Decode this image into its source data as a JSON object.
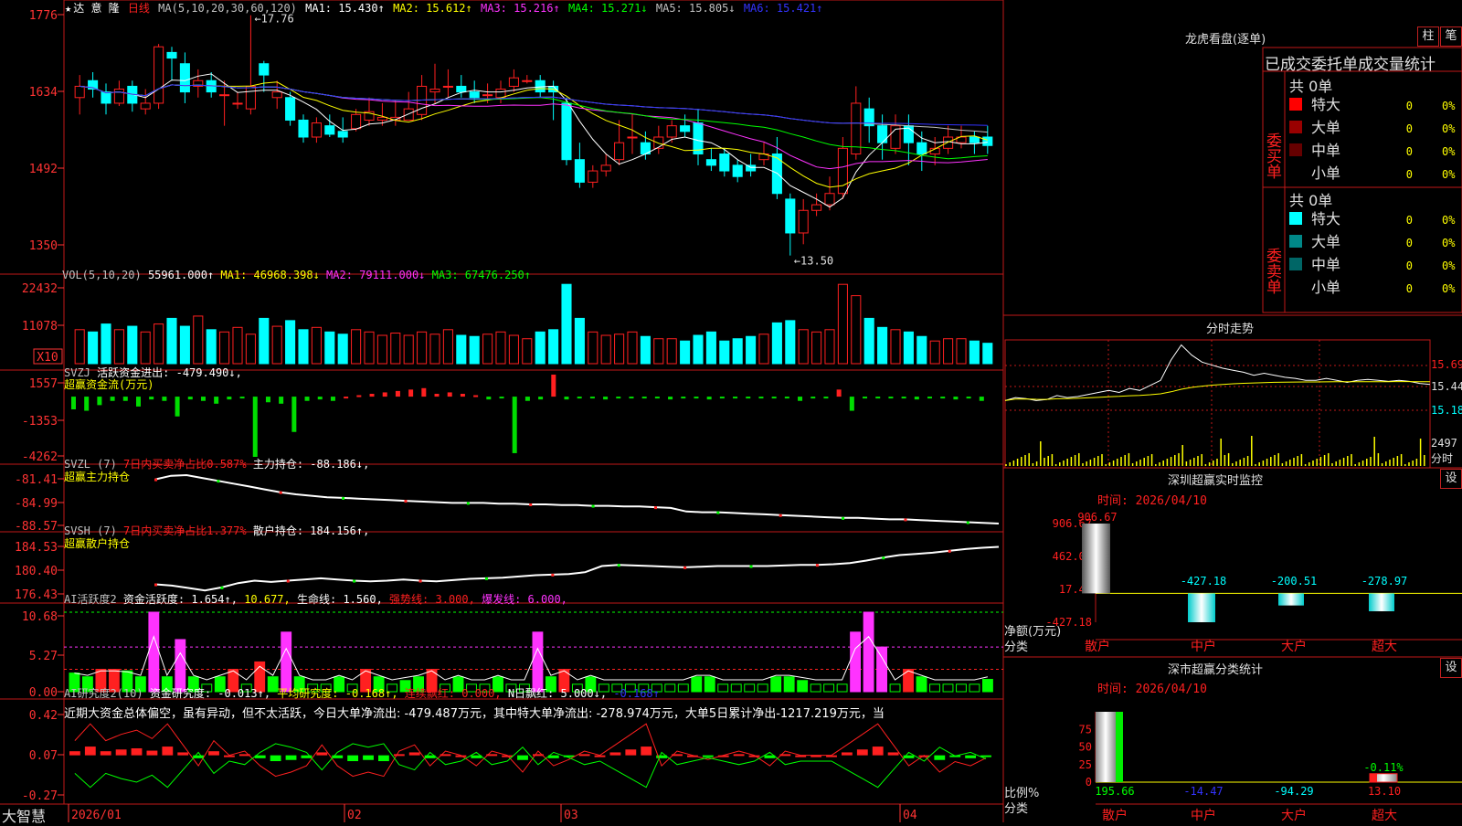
{
  "colors": {
    "up": "#ff2020",
    "down": "#00ffff",
    "frame": "#c01818",
    "axis": "#ff3333",
    "white": "#ffffff",
    "yellow": "#ffff00",
    "magenta": "#ff33ff",
    "green": "#00ff00",
    "blue": "#3333ff",
    "gray": "#c0c0c0",
    "cyan": "#00ffff"
  },
  "main": {
    "title_star": "★",
    "stock_name": "达 意 隆",
    "period": "日线",
    "ma_label": "MA(5,10,20,30,60,120)",
    "ma1": "MA1: 15.430↑",
    "ma2": "MA2: 15.612↑",
    "ma3": "MA3: 15.216↑",
    "ma4": "MA4: 15.271↓",
    "ma5": "MA5: 15.805↓",
    "ma6": "MA6: 15.421↑",
    "y_ticks": [
      "1776",
      "1634",
      "1492",
      "1350"
    ],
    "high_label": "←17.76",
    "low_label": "←13.50"
  },
  "vol": {
    "label": "VOL(5,10,20)",
    "value": "55961.000↑",
    "ma1": "MA1: 46968.398↓",
    "ma2": "MA2: 79111.000↓",
    "ma3": "MA3: 67476.250↑",
    "y_ticks": [
      "22432",
      "11078"
    ],
    "unit": "X10"
  },
  "svzj": {
    "label": "SVZJ",
    "text1": "活跃资金进出: -479.490↓,",
    "text2": "超赢资金流(万元)",
    "y_ticks": [
      "1557",
      "-1353",
      "-4262"
    ]
  },
  "svzl": {
    "label": "SVZL (7)",
    "text1": "7日内买卖净占比0.587%",
    "text2": "主力持仓: -88.186↓,",
    "text3": "超赢主力持仓",
    "y_ticks": [
      "-81.41",
      "-84.99",
      "-88.57"
    ]
  },
  "svsh": {
    "label": "SVSH (7)",
    "text1": "7日内买卖净占比1.377%",
    "text2": "散户持仓: 184.156↑,",
    "text3": "超赢散户持仓",
    "y_ticks": [
      "184.53",
      "180.40",
      "176.43"
    ]
  },
  "ai1": {
    "label": "AI活跃度2",
    "t1": "资金活跃度: 1.654↑,",
    "t2": "10.677,",
    "t3": "生命线: 1.560,",
    "t4": "强势线: 3.000,",
    "t5": "爆发线: 6.000,",
    "y_ticks": [
      "10.68",
      "5.27",
      "0.00"
    ]
  },
  "ai2": {
    "label": "AI研究度2(10)",
    "t1": "资金研究度: -0.013↑,",
    "t2": "平均研究度: -0.168↑,",
    "t3": "连续飘红: 0.000,",
    "t4": "N日飘红: 5.000↓,",
    "t5": "-0.168↑",
    "comment": "近期大资金总体偏空，虽有异动，但不太活跃，今日大单净流出: -479.487万元，其中特大单净流出: -278.974万元，大单5日累计净出-1217.219万元，当",
    "y_ticks": [
      "0.42",
      "0.07",
      "-0.27"
    ]
  },
  "xaxis": {
    "labels": [
      "2026/01",
      "02",
      "03",
      "04"
    ]
  },
  "bottom_left": "大智慧",
  "right": {
    "lh_title": "龙虎看盘(逐单)",
    "btn_zhu": "柱",
    "btn_bi": "笔",
    "stat_title": "已成交委托单成交量统计",
    "buy_side": "委买单",
    "sell_side": "委卖单",
    "buy_total": "共 0单",
    "sell_total": "共 0单",
    "buy_rows": [
      {
        "name": "特大",
        "v": "0",
        "p": "0%",
        "c": "#ff0000"
      },
      {
        "name": "大单",
        "v": "0",
        "p": "0%",
        "c": "#990000"
      },
      {
        "name": "中单",
        "v": "0",
        "p": "0%",
        "c": "#660000"
      },
      {
        "name": "小单",
        "v": "0",
        "p": "0%",
        "c": "#000000"
      }
    ],
    "sell_rows": [
      {
        "name": "特大",
        "v": "0",
        "p": "0%",
        "c": "#00ffff"
      },
      {
        "name": "大单",
        "v": "0",
        "p": "0%",
        "c": "#008888"
      },
      {
        "name": "中单",
        "v": "0",
        "p": "0%",
        "c": "#006666"
      },
      {
        "name": "小单",
        "v": "0",
        "p": "0%",
        "c": "#000000"
      }
    ],
    "fs_title": "分时走势",
    "fs_ticks": [
      "15.69",
      "15.44",
      "15.18"
    ],
    "fs_vol": "2497",
    "fs_vol_unit": "分时",
    "sz_title": "深圳超赢实时监控",
    "sz_btn": "设",
    "sz_time": "时间: 2026/04/10",
    "sz_ticks": [
      "906.67",
      "462.05",
      "17.44",
      "-427.18"
    ],
    "sz_ylabel": "净额(万元)",
    "sz_xlabel": "分类",
    "sz_cats": [
      "散户",
      "中户",
      "大户",
      "超大"
    ],
    "sz_vals": [
      906.67,
      -427.18,
      -200.51,
      -278.97
    ],
    "sz_val_labels": [
      "906.67",
      "-427.18",
      "-200.51",
      "-278.97"
    ],
    "ss_title": "深市超赢分类统计",
    "ss_btn": "设",
    "ss_time": "时间: 2026/04/10",
    "ss_ticks": [
      "75",
      "50",
      "25",
      "0"
    ],
    "ss_ylabel": "比例%",
    "ss_xlabel": "分类",
    "ss_cats": [
      "散户",
      "中户",
      "大户",
      "超大"
    ],
    "ss_bottom_vals": [
      "195.66",
      "-14.47",
      "-94.29",
      "13.10"
    ],
    "ss_top_val": "-0.11%"
  },
  "chart_data": {
    "type": "candlestick",
    "title": "达 意 隆 日线",
    "ylim": [
      13.3,
      17.9
    ],
    "high": 17.76,
    "low": 13.5,
    "ma_periods": [
      5,
      10,
      20,
      30,
      60,
      120
    ],
    "candles": [
      [
        16.3,
        16.5,
        16.7,
        16.0
      ],
      [
        16.6,
        16.45,
        16.75,
        16.3
      ],
      [
        16.4,
        16.2,
        16.55,
        16.0
      ],
      [
        16.2,
        16.45,
        16.6,
        16.15
      ],
      [
        16.5,
        16.2,
        16.6,
        16.05
      ],
      [
        16.1,
        16.2,
        16.45,
        16.0
      ],
      [
        16.2,
        17.2,
        17.25,
        16.1
      ],
      [
        17.1,
        17.0,
        17.2,
        16.6
      ],
      [
        16.9,
        16.4,
        17.1,
        16.2
      ],
      [
        16.5,
        16.6,
        16.8,
        16.3
      ],
      [
        16.6,
        16.4,
        16.75,
        16.3
      ],
      [
        16.35,
        16.35,
        16.6,
        15.8
      ],
      [
        16.2,
        16.2,
        16.4,
        16.1
      ],
      [
        16.1,
        16.5,
        17.76,
        16.0
      ],
      [
        16.9,
        16.7,
        16.95,
        16.4
      ],
      [
        16.3,
        16.4,
        16.6,
        16.1
      ],
      [
        16.3,
        15.9,
        16.4,
        15.8
      ],
      [
        15.9,
        15.6,
        16.0,
        15.5
      ],
      [
        15.6,
        15.85,
        15.95,
        15.5
      ],
      [
        15.8,
        15.65,
        16.0,
        15.6
      ],
      [
        15.7,
        15.6,
        15.95,
        15.5
      ],
      [
        15.75,
        16.0,
        16.1,
        15.7
      ],
      [
        15.9,
        16.05,
        16.3,
        15.8
      ],
      [
        15.9,
        15.95,
        16.2,
        15.8
      ],
      [
        15.9,
        15.95,
        16.25,
        15.8
      ],
      [
        15.9,
        16.1,
        16.4,
        15.9
      ],
      [
        16.0,
        16.5,
        16.7,
        15.9
      ],
      [
        16.4,
        16.45,
        16.9,
        16.2
      ],
      [
        16.5,
        16.5,
        16.8,
        16.3
      ],
      [
        16.5,
        16.4,
        16.7,
        16.3
      ],
      [
        16.4,
        16.3,
        16.6,
        16.2
      ],
      [
        16.35,
        16.35,
        16.55,
        16.2
      ],
      [
        16.3,
        16.45,
        16.6,
        16.2
      ],
      [
        16.5,
        16.65,
        16.8,
        16.4
      ],
      [
        16.6,
        16.6,
        16.7,
        16.55
      ],
      [
        16.6,
        16.4,
        16.7,
        16.3
      ],
      [
        16.5,
        16.4,
        16.6,
        15.9
      ],
      [
        16.2,
        15.2,
        16.3,
        15.1
      ],
      [
        15.2,
        14.8,
        15.5,
        14.7
      ],
      [
        14.8,
        15.0,
        15.1,
        14.7
      ],
      [
        15.0,
        15.1,
        15.3,
        14.9
      ],
      [
        15.2,
        15.5,
        15.9,
        15.1
      ],
      [
        15.6,
        15.6,
        16.0,
        15.3
      ],
      [
        15.5,
        15.3,
        15.7,
        15.2
      ],
      [
        15.4,
        15.6,
        15.8,
        15.3
      ],
      [
        15.6,
        15.8,
        15.9,
        15.5
      ],
      [
        15.8,
        15.7,
        16.0,
        15.6
      ],
      [
        15.85,
        15.3,
        16.1,
        15.1
      ],
      [
        15.2,
        15.1,
        15.4,
        15.0
      ],
      [
        15.3,
        15.0,
        15.4,
        14.9
      ],
      [
        15.1,
        14.9,
        15.2,
        14.8
      ],
      [
        15.1,
        15.0,
        15.3,
        14.9
      ],
      [
        15.2,
        15.3,
        15.5,
        15.1
      ],
      [
        15.3,
        14.6,
        15.6,
        14.5
      ],
      [
        14.5,
        13.9,
        14.6,
        13.5
      ],
      [
        13.9,
        14.3,
        14.5,
        13.7
      ],
      [
        14.3,
        14.4,
        14.6,
        14.2
      ],
      [
        14.4,
        14.6,
        14.9,
        14.3
      ],
      [
        14.6,
        15.4,
        15.6,
        14.5
      ],
      [
        15.3,
        16.2,
        16.5,
        15.2
      ],
      [
        16.1,
        15.8,
        16.3,
        15.5
      ],
      [
        15.8,
        15.5,
        16.0,
        15.2
      ],
      [
        15.4,
        15.8,
        16.0,
        15.3
      ],
      [
        15.8,
        15.5,
        16.0,
        15.1
      ],
      [
        15.5,
        15.3,
        15.7,
        15.0
      ],
      [
        15.3,
        15.4,
        15.6,
        15.1
      ],
      [
        15.4,
        15.6,
        15.8,
        15.3
      ],
      [
        15.5,
        15.6,
        15.8,
        15.4
      ],
      [
        15.6,
        15.5,
        15.7,
        15.3
      ],
      [
        15.6,
        15.45,
        15.8,
        15.3
      ]
    ],
    "volume": [
      30,
      28,
      35,
      30,
      33,
      28,
      35,
      40,
      33,
      42,
      30,
      28,
      32,
      26,
      40,
      33,
      38,
      30,
      32,
      28,
      26,
      30,
      28,
      25,
      27,
      25,
      28,
      26,
      30,
      25,
      24,
      26,
      28,
      25,
      22,
      28,
      30,
      70,
      40,
      28,
      25,
      26,
      28,
      24,
      22,
      22,
      20,
      25,
      28,
      20,
      22,
      24,
      26,
      36,
      38,
      30,
      28,
      30,
      70,
      60,
      40,
      32,
      30,
      28,
      24,
      20,
      22,
      22,
      20,
      18
    ],
    "svzj": [
      -900,
      -1000,
      -600,
      -300,
      -300,
      -700,
      -200,
      -300,
      -1400,
      -200,
      -300,
      -500,
      -200,
      -100,
      -4262,
      -400,
      -500,
      -2500,
      -300,
      -200,
      -300,
      0,
      100,
      200,
      300,
      400,
      500,
      600,
      200,
      300,
      200,
      100,
      -200,
      -100,
      -4000,
      -300,
      -200,
      1557,
      -200,
      -100,
      -100,
      -200,
      -100,
      -100,
      -100,
      -100,
      -200,
      -100,
      -100,
      -200,
      -100,
      -100,
      -100,
      -100,
      -100,
      -100,
      -300,
      -100,
      -100,
      500,
      -1000,
      -100,
      -100,
      -100,
      -100,
      -200,
      -100,
      -100,
      -200,
      -100,
      -300
    ],
    "svzl": [
      -82.0,
      -81.5,
      -81.41,
      -81.8,
      -82.2,
      -82.6,
      -83.0,
      -83.4,
      -83.8,
      -84.1,
      -84.3,
      -84.5,
      -84.6,
      -84.7,
      -84.8,
      -84.9,
      -85.0,
      -85.1,
      -85.2,
      -85.3,
      -85.3,
      -85.3,
      -85.4,
      -85.4,
      -85.5,
      -85.5,
      -85.6,
      -85.6,
      -85.7,
      -85.7,
      -85.8,
      -85.8,
      -85.9,
      -86.0,
      -86.5,
      -86.6,
      -86.6,
      -86.7,
      -86.8,
      -86.9,
      -87.0,
      -87.1,
      -87.2,
      -87.3,
      -87.4,
      -87.4,
      -87.5,
      -87.6,
      -87.6,
      -87.7,
      -87.8,
      -87.9,
      -88.0,
      -88.1,
      -88.186
    ],
    "svsh": [
      178.0,
      177.8,
      177.4,
      177.0,
      177.5,
      178.2,
      178.6,
      178.4,
      178.6,
      178.8,
      179.0,
      178.8,
      178.6,
      178.5,
      178.6,
      178.8,
      178.6,
      178.5,
      178.7,
      178.9,
      179.0,
      179.1,
      179.3,
      179.5,
      179.6,
      179.7,
      180.0,
      181.0,
      181.2,
      181.1,
      181.0,
      180.9,
      180.8,
      180.9,
      181.0,
      181.0,
      181.0,
      181.0,
      181.1,
      181.2,
      181.2,
      181.3,
      181.5,
      181.9,
      182.4,
      182.8,
      183.0,
      183.2,
      183.5,
      183.8,
      184.0,
      184.156
    ],
    "ai_activity": [
      2.5,
      2.0,
      3.0,
      3.0,
      2.8,
      2.0,
      10.677,
      2.0,
      7.0,
      2.0,
      1.0,
      2.0,
      3.0,
      1.0,
      4.0,
      2.0,
      8.0,
      2.0,
      1.0,
      1.0,
      2.0,
      1.0,
      3.0,
      2.0,
      1.0,
      1.5,
      2.0,
      3.0,
      1.0,
      2.0,
      1.0,
      1.0,
      2.0,
      1.0,
      1.0,
      8.0,
      2.0,
      3.0,
      1.0,
      2.0,
      1.0,
      1.0,
      1.0,
      1.0,
      1.0,
      1.0,
      1.0,
      2.0,
      2.0,
      1.0,
      1.0,
      1.0,
      1.0,
      2.0,
      2.0,
      1.5,
      1.0,
      1.0,
      1.0,
      8.0,
      10.677,
      6.0,
      1.0,
      3.0,
      2.0,
      1.0,
      1.0,
      1.0,
      1.0,
      1.654
    ],
    "ai_research": [
      0.07,
      0.15,
      0.07,
      0.1,
      0.12,
      0.08,
      0.15,
      0.05,
      -0.05,
      0.07,
      0.0,
      0.02,
      -0.05,
      -0.1,
      -0.08,
      -0.05,
      0.05,
      -0.05,
      -0.1,
      -0.08,
      -0.1,
      0.02,
      0.05,
      -0.05,
      0.02,
      0.0,
      -0.05,
      0.02,
      0.0,
      -0.08,
      0.02,
      -0.05,
      -0.02,
      0.02,
      0.0,
      0.05,
      0.1,
      0.15,
      -0.05,
      0.02,
      0.0,
      -0.02,
      0.0,
      0.02,
      0.0,
      -0.05,
      0.02,
      0.0,
      0.0,
      0.0,
      0.05,
      0.1,
      0.15,
      0.05,
      -0.05,
      0.0,
      -0.08,
      -0.03,
      -0.05,
      -0.013
    ],
    "fenshi": [
      15.3,
      15.33,
      15.32,
      15.3,
      15.31,
      15.35,
      15.33,
      15.34,
      15.36,
      15.38,
      15.4,
      15.38,
      15.42,
      15.4,
      15.45,
      15.5,
      15.7,
      15.85,
      15.75,
      15.68,
      15.65,
      15.62,
      15.6,
      15.58,
      15.55,
      15.57,
      15.55,
      15.53,
      15.52,
      15.5,
      15.5,
      15.52,
      15.5,
      15.48,
      15.5,
      15.51,
      15.5,
      15.49,
      15.5,
      15.49,
      15.47,
      15.46
    ],
    "shenzhen_monitor": {
      "categories": [
        "散户",
        "中户",
        "大户",
        "超大"
      ],
      "values": [
        906.67,
        -427.18,
        -200.51,
        -278.97
      ],
      "ylim": [
        -427.18,
        906.67
      ]
    },
    "shenshi_stats": {
      "categories": [
        "散户",
        "中户",
        "大户",
        "超大"
      ],
      "bar_values": [
        100,
        0,
        0,
        12
      ],
      "labels": [
        "195.66",
        "-14.47",
        "-94.29",
        "13.10"
      ],
      "top_label": "-0.11%"
    }
  }
}
